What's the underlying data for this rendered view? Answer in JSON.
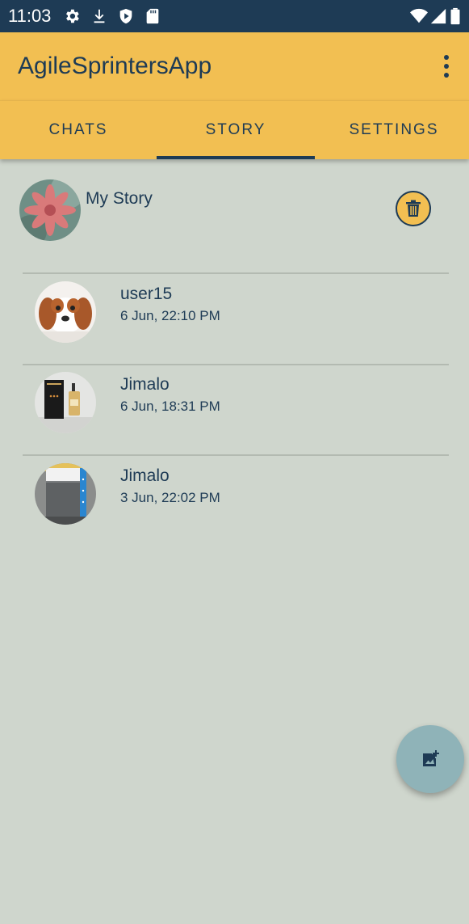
{
  "status_bar": {
    "time": "11:03",
    "left_icons": [
      "settings-icon",
      "download-icon",
      "shield-play-icon",
      "sd-card-icon"
    ],
    "right_icons": [
      "wifi-icon",
      "signal-icon",
      "battery-icon"
    ]
  },
  "app_bar": {
    "title": "AgileSprintersApp",
    "menu_icon": "more-vert-icon"
  },
  "tabs": [
    {
      "label": "CHATS",
      "selected": false
    },
    {
      "label": "STORY",
      "selected": true
    },
    {
      "label": "SETTINGS",
      "selected": false
    }
  ],
  "my_story": {
    "label": "My Story",
    "delete_icon": "trash-icon"
  },
  "stories": [
    {
      "name": "user15",
      "time": "6 Jun, 22:10 PM"
    },
    {
      "name": "Jimalo",
      "time": "6 Jun, 18:31 PM"
    },
    {
      "name": "Jimalo",
      "time": "3 Jun, 22:02 PM"
    }
  ],
  "fab": {
    "icon": "add-photo-icon"
  },
  "colors": {
    "status_bar": "#1e3b55",
    "app_bar": "#f2bf52",
    "background": "#cfd6cd",
    "text": "#1e3b55",
    "fab": "#8fb3b8"
  }
}
